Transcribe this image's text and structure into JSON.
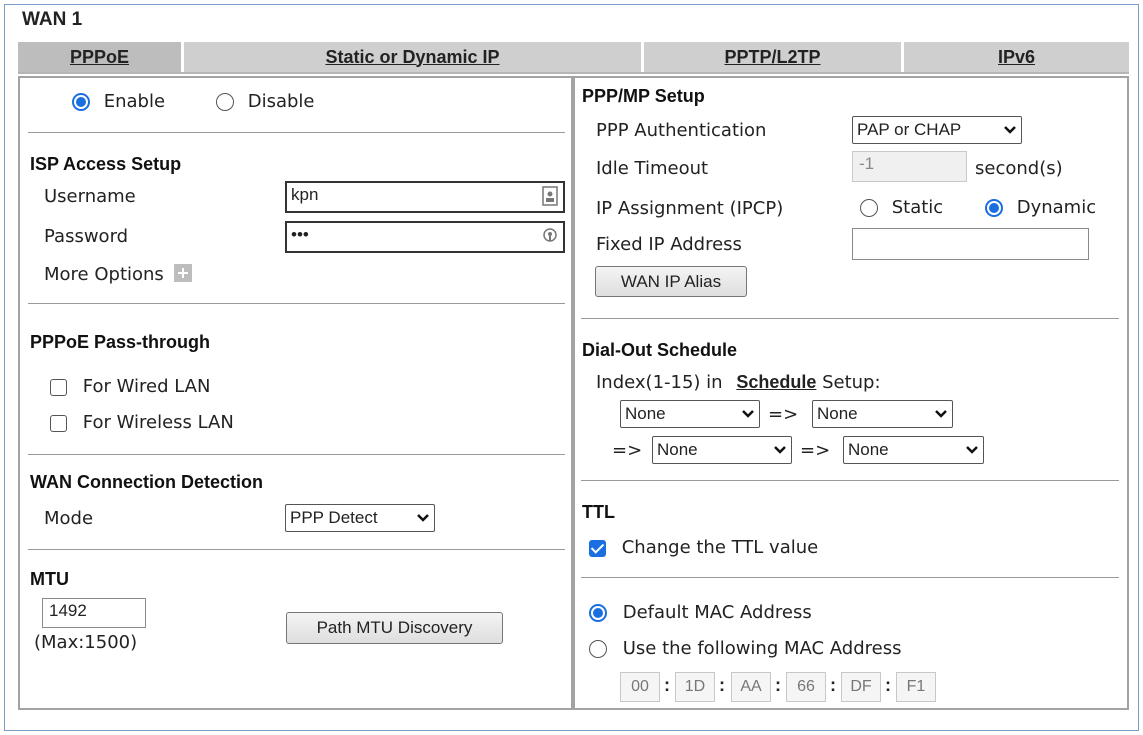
{
  "title": "WAN 1",
  "tabs": [
    "PPPoE",
    "Static or Dynamic IP",
    "PPTP/L2TP",
    "IPv6"
  ],
  "active_tab": "PPPoE",
  "left": {
    "enable_label": "Enable",
    "disable_label": "Disable",
    "enabled": true,
    "isp": {
      "heading": "ISP Access Setup",
      "username_label": "Username",
      "username_value": "kpn",
      "password_label": "Password",
      "password_value": "•••",
      "more_options_label": "More Options"
    },
    "passthrough": {
      "heading": "PPPoE Pass-through",
      "wired_label": "For Wired LAN",
      "wireless_label": "For Wireless LAN",
      "wired_checked": false,
      "wireless_checked": false
    },
    "detection": {
      "heading": "WAN Connection Detection",
      "mode_label": "Mode",
      "mode_value": "PPP Detect"
    },
    "mtu": {
      "heading": "MTU",
      "value": "1492",
      "max_label": "(Max:1500)",
      "discovery_button": "Path MTU Discovery"
    }
  },
  "right": {
    "ppp": {
      "heading": "PPP/MP Setup",
      "auth_label": "PPP Authentication",
      "auth_value": "PAP or CHAP",
      "idle_label": "Idle Timeout",
      "idle_value": "-1",
      "idle_unit": "second(s)",
      "ip_assign_label": "IP Assignment (IPCP)",
      "static_label": "Static",
      "dynamic_label": "Dynamic",
      "ip_assign_value": "Dynamic",
      "fixed_ip_label": "Fixed IP Address",
      "fixed_ip_value": "",
      "alias_button": "WAN IP Alias"
    },
    "schedule": {
      "heading": "Dial-Out Schedule",
      "index_prefix": "Index(1-15) in",
      "schedule_link": "Schedule",
      "index_suffix": "Setup:",
      "arrow": "=>",
      "slots": [
        "None",
        "None",
        "None",
        "None"
      ]
    },
    "ttl": {
      "heading": "TTL",
      "change_label": "Change the TTL value",
      "checked": true
    },
    "mac": {
      "default_label": "Default MAC Address",
      "custom_label": "Use the following MAC Address",
      "selected": "default",
      "octets": [
        "00",
        "1D",
        "AA",
        "66",
        "DF",
        "F1"
      ],
      "separator": ":"
    }
  }
}
